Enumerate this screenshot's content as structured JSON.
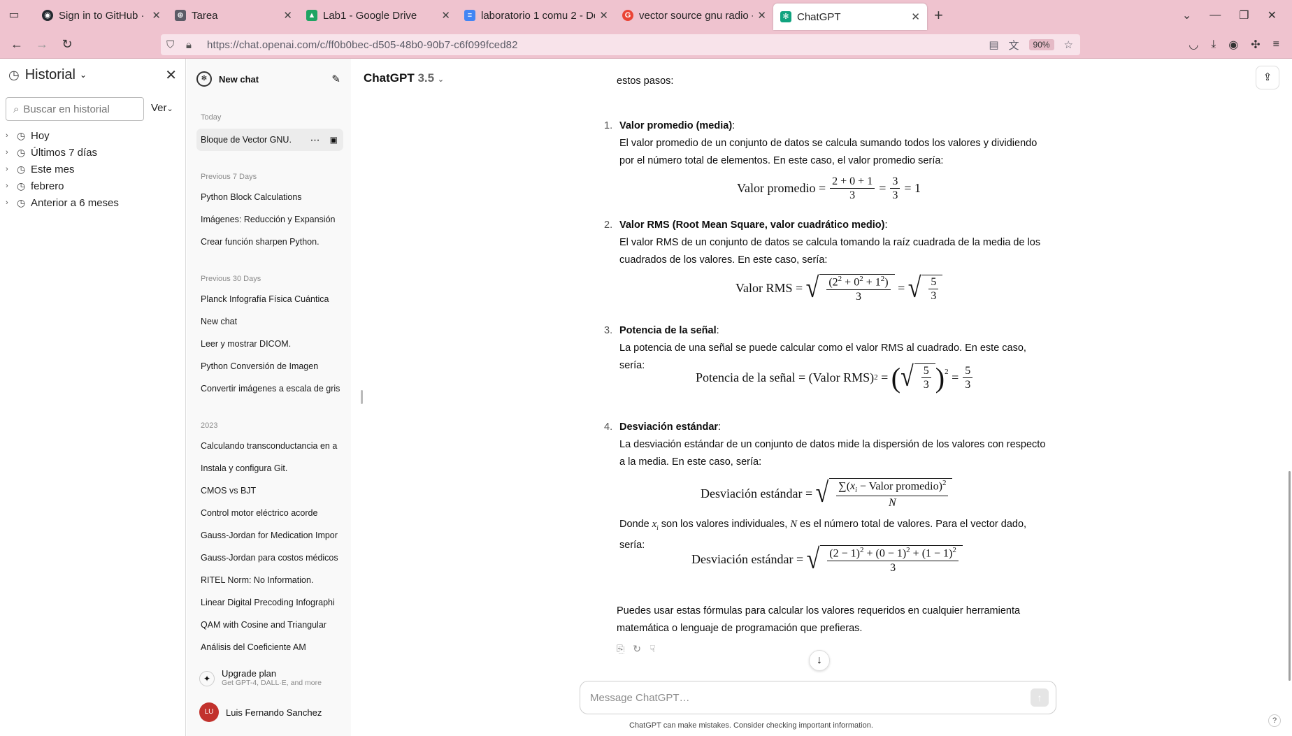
{
  "browser": {
    "tabs": [
      {
        "title": "Sign in to GitHub · GitHub",
        "icon": "github-icon",
        "color": "#24292f",
        "active": false
      },
      {
        "title": "Tarea",
        "icon": "gamepad-icon",
        "color": "#5b5b66",
        "active": false
      },
      {
        "title": "Lab1 - Google Drive",
        "icon": "drive-icon",
        "color": "#1fa463",
        "active": false
      },
      {
        "title": "laboratorio 1 comu 2 - Do",
        "icon": "docs-icon",
        "color": "#4285f4",
        "active": false
      },
      {
        "title": "vector source gnu radio -",
        "icon": "google-icon",
        "color": "#ea4335",
        "active": false
      },
      {
        "title": "ChatGPT",
        "icon": "chatgpt-icon",
        "color": "#10a37f",
        "active": true
      }
    ],
    "url": "https://chat.openai.com/c/ff0b0bec-d505-48b0-90b7-c6f099fced82",
    "zoom": "90%"
  },
  "history_panel": {
    "title": "Historial",
    "search_placeholder": "Buscar en historial",
    "view_label": "Ver",
    "items": [
      "Hoy",
      "Últimos 7 días",
      "Este mes",
      "febrero",
      "Anterior a 6 meses"
    ]
  },
  "sidebar": {
    "new_chat": "New chat",
    "sections": {
      "today": "Today",
      "prev7": "Previous 7 Days",
      "prev30": "Previous 30 Days",
      "y2023": "2023"
    },
    "active_chat": "Bloque de Vector GNU.",
    "prev7_items": [
      "Python Block Calculations",
      "Imágenes: Reducción y Expansión",
      "Crear función sharpen Python."
    ],
    "prev30_items": [
      "Planck Infografía Física Cuántica",
      "New chat",
      "Leer y mostrar DICOM.",
      "Python Conversión de Imagen",
      "Convertir imágenes a escala de gris"
    ],
    "y2023_items": [
      "Calculando transconductancia en a",
      "Instala y configura Git.",
      "CMOS vs BJT",
      "Control motor eléctrico acorde",
      "Gauss-Jordan for Medication Impor",
      "Gauss-Jordan para costos médicos",
      "RITEL Norm: No Information.",
      "Linear Digital Precoding Infographi",
      "QAM with Cosine and Triangular",
      "Análisis del Coeficiente AM"
    ],
    "upgrade_title": "Upgrade plan",
    "upgrade_sub": "Get GPT-4, DALL·E, and more",
    "user_initials": "LU",
    "user_name": "Luis Fernando Sanchez"
  },
  "main": {
    "model_name": "ChatGPT",
    "model_version": "3.5",
    "intro_fragment": "estos pasos:",
    "steps": [
      {
        "num": "1.",
        "heading": "Valor promedio (media)",
        "text": "El valor promedio de un conjunto de datos se calcula sumando todos los valores y dividiendo por el número total de elementos. En este caso, el valor promedio sería:"
      },
      {
        "num": "2.",
        "heading": "Valor RMS (Root Mean Square, valor cuadrático medio)",
        "text": "El valor RMS de un conjunto de datos se calcula tomando la raíz cuadrada de la media de los cuadrados de los valores. En este caso, sería:"
      },
      {
        "num": "3.",
        "heading": "Potencia de la señal",
        "text": "La potencia de una señal se puede calcular como el valor RMS al cuadrado. En este caso, sería:"
      },
      {
        "num": "4.",
        "heading": "Desviación estándar",
        "text": "La desviación estándar de un conjunto de datos mide la dispersión de los valores con respecto a la media. En este caso, sería:"
      }
    ],
    "formulas": {
      "mean_label": "Valor promedio",
      "mean_num": "2 + 0 + 1",
      "mean_den": "3",
      "mean_num2": "3",
      "mean_den2": "3",
      "mean_result": "= 1",
      "rms_label": "Valor RMS",
      "rms_den": "3",
      "rms_frac_num": "5",
      "rms_frac_den": "3",
      "power_label": "Potencia de la señal",
      "power_mid": "(Valor RMS)",
      "power_res_num": "5",
      "power_res_den": "3",
      "std_label": "Desviación estándar",
      "std_den": "N",
      "std_den2": "3"
    },
    "where_text_a": "Donde",
    "where_text_b": "son los valores individuales,",
    "where_text_c": "es el número total de valores. Para el vector dado, sería:",
    "closing": "Puedes usar estas fórmulas para calcular los valores requeridos en cualquier herramienta matemática o lenguaje de programación que prefieras.",
    "composer_placeholder": "Message ChatGPT…",
    "disclaimer": "ChatGPT can make mistakes. Consider checking important information."
  }
}
